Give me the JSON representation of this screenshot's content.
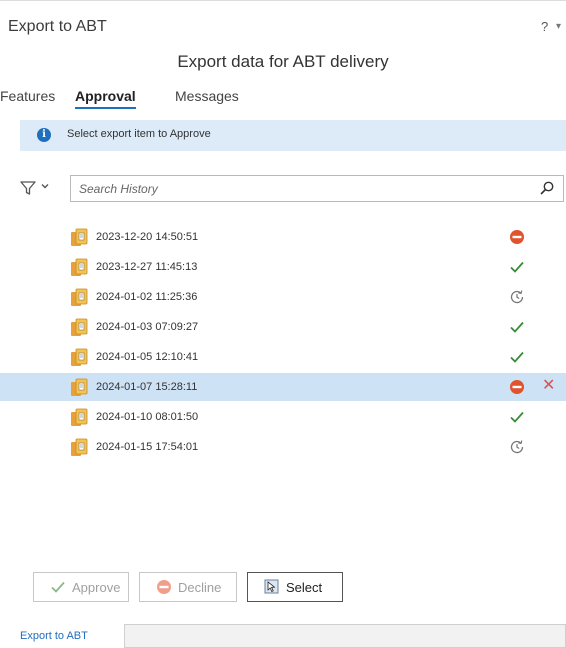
{
  "pane": {
    "title": "Export to ABT",
    "help": "?",
    "help_dropdown": "▾"
  },
  "subtitle": "Export data for ABT delivery",
  "tabs": [
    {
      "label": "Features",
      "active": false
    },
    {
      "label": "Approval",
      "active": true
    },
    {
      "label": "Messages",
      "active": false
    }
  ],
  "info": {
    "text": "Select export item to Approve",
    "icon": "info-icon"
  },
  "search": {
    "placeholder": "Search History",
    "value": ""
  },
  "history": [
    {
      "date": "2023-12-20 14:50:51",
      "status": "declined",
      "selected": false
    },
    {
      "date": "2023-12-27 11:45:13",
      "status": "approved",
      "selected": false
    },
    {
      "date": "2024-01-02 11:25:36",
      "status": "pending",
      "selected": false
    },
    {
      "date": "2024-01-03 07:09:27",
      "status": "approved",
      "selected": false
    },
    {
      "date": "2024-01-05 12:10:41",
      "status": "approved",
      "selected": false
    },
    {
      "date": "2024-01-07 15:28:11",
      "status": "declined",
      "selected": true
    },
    {
      "date": "2024-01-10 08:01:50",
      "status": "approved",
      "selected": false
    },
    {
      "date": "2024-01-15 17:54:01",
      "status": "pending",
      "selected": false
    }
  ],
  "actions": {
    "approve_label": "Approve",
    "decline_label": "Decline",
    "select_label": "Select"
  },
  "footer": {
    "tab_label": "Export to ABT"
  },
  "colors": {
    "accent": "#1f6fbf",
    "approved": "#3a8a3a",
    "declined": "#e0532c",
    "pending": "#777777",
    "selected_row": "#cde2f5"
  }
}
